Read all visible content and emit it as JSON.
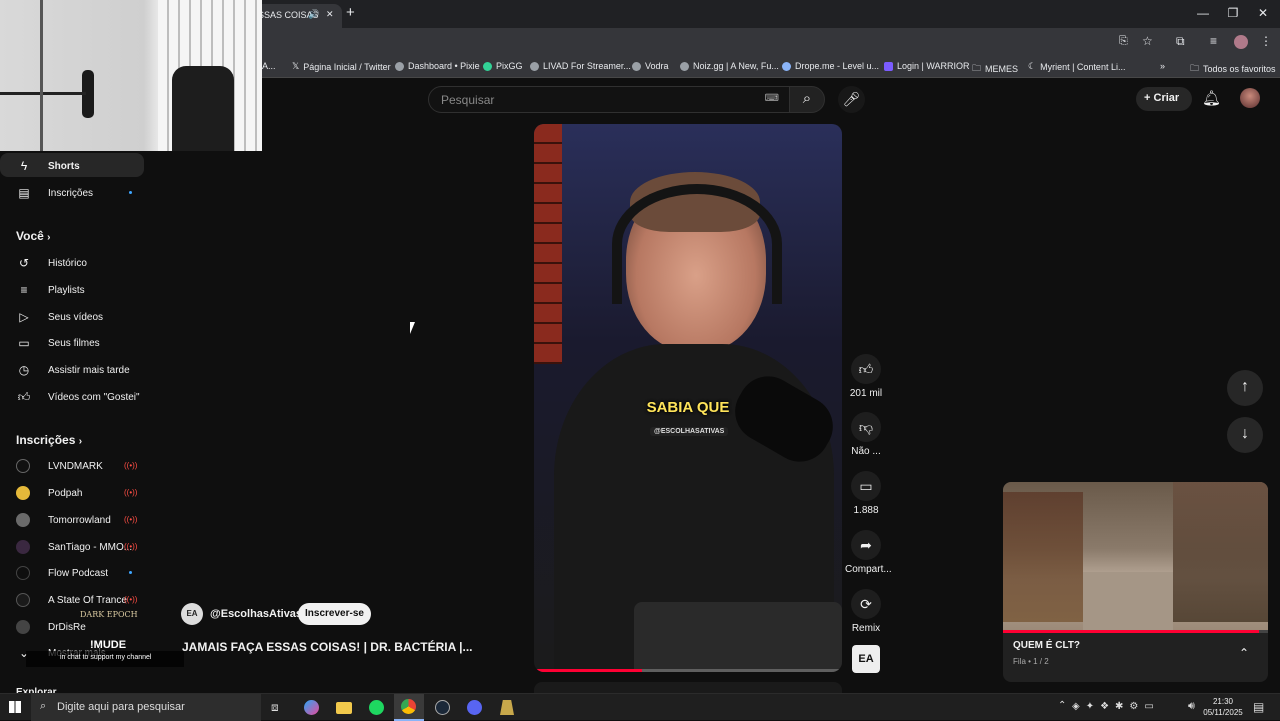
{
  "browser": {
    "tab_title": "SSAS COISAS",
    "bookmarks": [
      {
        "label": "Página Inicial / Twitter"
      },
      {
        "label": "Dashboard • Pixie"
      },
      {
        "label": "PixGG"
      },
      {
        "label": "LIVAD For Streamer..."
      },
      {
        "label": "Vodra"
      },
      {
        "label": "Noiz.gg | A New, Fu..."
      },
      {
        "label": "Drope.me - Level u..."
      },
      {
        "label": "Login | WARRIOR"
      },
      {
        "label": "MEMES"
      },
      {
        "label": "Myrient | Content Li..."
      }
    ],
    "all_bookmarks": "Todos os favoritos"
  },
  "header": {
    "search_placeholder": "Pesquisar",
    "create_label": "Criar"
  },
  "sidebar": {
    "shorts": "Shorts",
    "subscriptions": "Inscrições",
    "you_heading": "Você",
    "you_items": [
      {
        "label": "Histórico",
        "icon": "history-icon"
      },
      {
        "label": "Playlists",
        "icon": "playlist-icon"
      },
      {
        "label": "Seus vídeos",
        "icon": "your-videos-icon"
      },
      {
        "label": "Seus filmes",
        "icon": "movies-icon"
      },
      {
        "label": "Assistir mais tarde",
        "icon": "watch-later-icon"
      },
      {
        "label": "Vídeos com \"Gostei\"",
        "icon": "liked-icon"
      }
    ],
    "subs_heading": "Inscrições",
    "channels": [
      {
        "name": "LVNDMARK",
        "status": "live"
      },
      {
        "name": "Podpah",
        "status": "live"
      },
      {
        "name": "Tomorrowland",
        "status": "live"
      },
      {
        "name": "SanTiago - MMO...",
        "status": "live"
      },
      {
        "name": "Flow Podcast",
        "status": "new"
      },
      {
        "name": "A State Of Trance",
        "status": "live"
      },
      {
        "name": "DrDisRe",
        "status": ""
      }
    ],
    "show_more": "Mostrar mais",
    "explore": "Explorar"
  },
  "overlay": {
    "brand": "DARK EPOCH",
    "command": "!MUDE",
    "support_text": "in chat to support my channel"
  },
  "video": {
    "caption": "SABIA QUE",
    "handle_watermark": "@ESCOLHASATIVAS",
    "channel": "@EscolhasAtivas",
    "subscribe_label": "Inscrever-se",
    "title": "JAMAIS FAÇA ESSAS COISAS! | DR. BACTÉRIA |...",
    "progress": 0.35
  },
  "actions": {
    "likes": "201 mil",
    "dislike": "Não ...",
    "comments": "1.888",
    "share": "Compart...",
    "remix": "Remix",
    "channel_logo": "EA"
  },
  "mini_player": {
    "title": "QUEM É CLT?",
    "queue": "Fila • 1 / 2"
  },
  "taskbar": {
    "search_placeholder": "Digite aqui para pesquisar",
    "time": "21:30",
    "date": "05/11/2025"
  }
}
